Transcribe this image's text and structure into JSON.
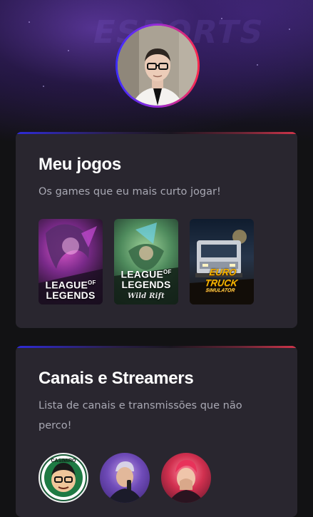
{
  "profile": {
    "avatar_alt": "Foto de perfil"
  },
  "games_card": {
    "title": "Meu jogos",
    "subtitle": "Os games que eu mais curto jogar!",
    "games": [
      {
        "name": "League of Legends",
        "logo_line1": "LEAGUE",
        "logo_of": "OF",
        "logo_line2": "LEGENDS"
      },
      {
        "name": "League of Legends: Wild Rift",
        "logo_line1": "LEAGUE",
        "logo_of": "OF",
        "logo_line2": "LEGENDS",
        "logo_tag": "Wild Rift"
      },
      {
        "name": "Euro Truck Simulator",
        "logo_line1": "EURO TRUCK",
        "logo_line2": "SIMULATOR"
      }
    ]
  },
  "streamers_card": {
    "title": "Canais e Streamers",
    "subtitle": "Lista de canais e transmissões que não perco!",
    "streamers": [
      {
        "name": "Casimiro",
        "badge_text": "CASIMIRO"
      },
      {
        "name": "Streamer 2"
      },
      {
        "name": "Streamer 3"
      }
    ]
  },
  "colors": {
    "background": "#121214",
    "card": "#29262f",
    "title": "#ffffff",
    "subtitle": "#a8a8b3",
    "accent_blue": "#2f2bd9",
    "accent_red": "#d1344a"
  }
}
